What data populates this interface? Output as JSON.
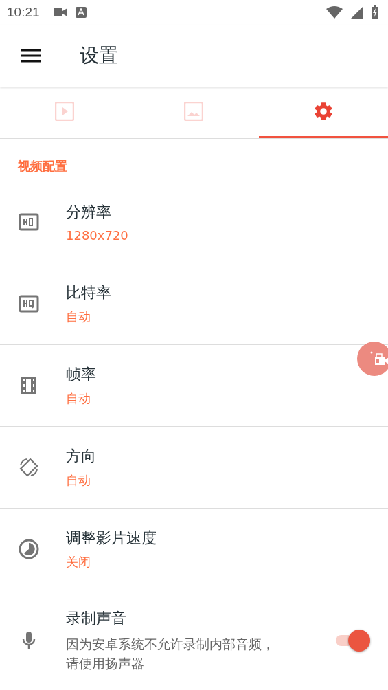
{
  "status_bar": {
    "time": "10:21"
  },
  "app_bar": {
    "title": "设置"
  },
  "tabs": [
    {
      "selected": false
    },
    {
      "selected": false
    },
    {
      "selected": true
    }
  ],
  "section": {
    "title": "视频配置"
  },
  "settings": [
    {
      "kind": "value",
      "title": "分辨率",
      "value": "1280x720"
    },
    {
      "kind": "value",
      "title": "比特率",
      "value": "自动"
    },
    {
      "kind": "value",
      "title": "帧率",
      "value": "自动"
    },
    {
      "kind": "value",
      "title": "方向",
      "value": "自动"
    },
    {
      "kind": "value",
      "title": "调整影片速度",
      "value": "关闭"
    },
    {
      "kind": "toggle",
      "title": "录制声音",
      "description": "因为安卓系统不允许录制内部音频，请使用扬声器",
      "on": true
    }
  ]
}
